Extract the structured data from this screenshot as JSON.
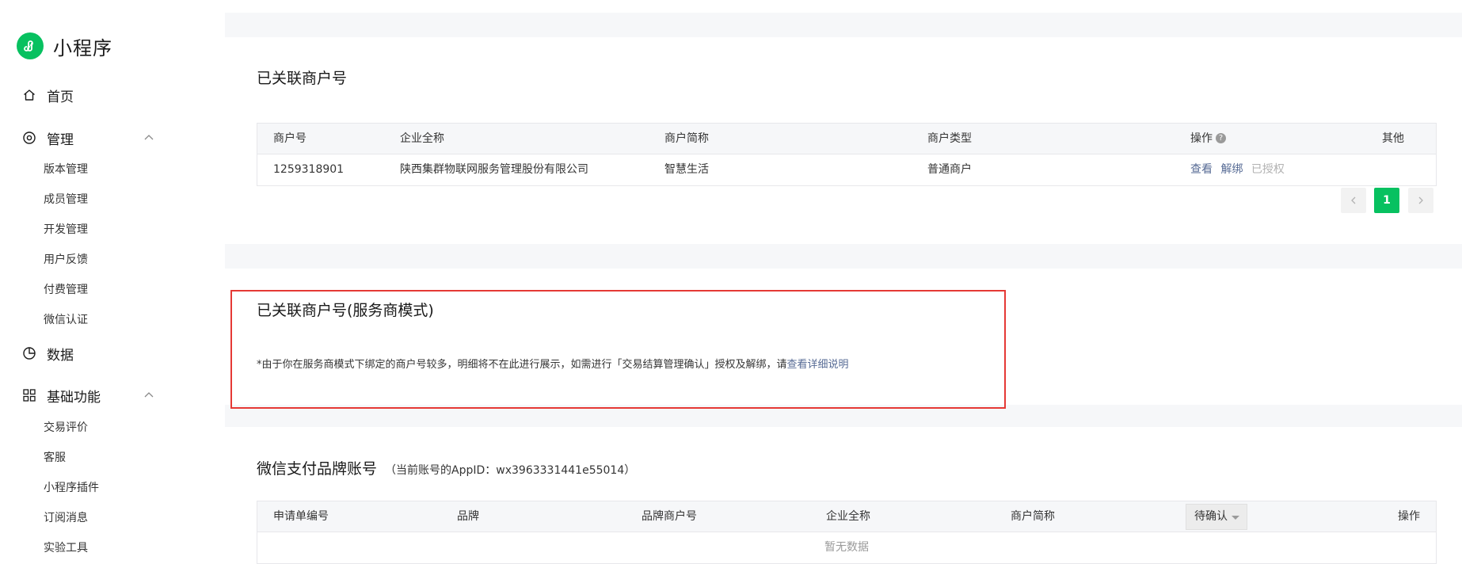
{
  "app": {
    "title": "小程序"
  },
  "sidebar": {
    "home": "首页",
    "manage": {
      "label": "管理",
      "items": [
        "版本管理",
        "成员管理",
        "开发管理",
        "用户反馈",
        "付费管理",
        "微信认证"
      ]
    },
    "data": "数据",
    "basic": {
      "label": "基础功能",
      "items": [
        "交易评价",
        "客服",
        "小程序插件",
        "订阅消息",
        "实验工具"
      ]
    }
  },
  "merchants": {
    "title": "已关联商户号",
    "columns": {
      "id": "商户号",
      "company": "企业全称",
      "short": "商户简称",
      "type": "商户类型",
      "ops": "操作",
      "other": "其他"
    },
    "rows": [
      {
        "id": "1259318901",
        "company": "陕西集群物联网服务管理股份有限公司",
        "short": "智慧生活",
        "type": "普通商户",
        "view": "查看",
        "unbind": "解绑",
        "authorized": "已授权"
      }
    ],
    "pagination": {
      "current": "1"
    }
  },
  "service_mode": {
    "title": "已关联商户号(服务商模式)",
    "notice": "*由于你在服务商模式下绑定的商户号较多，明细将不在此进行展示，如需进行「交易结算管理确认」授权及解绑，请",
    "notice_link": "查看详细说明"
  },
  "brand_account": {
    "title": "微信支付品牌账号",
    "subtitle": "（当前账号的AppID：wx3963331441e55014）",
    "columns": {
      "apply_no": "申请单编号",
      "brand": "品牌",
      "brand_merchant": "品牌商户号",
      "company": "企业全称",
      "short": "商户简称",
      "status_filter": "待确认",
      "ops": "操作"
    },
    "empty": "暂无数据"
  },
  "colors": {
    "accent": "#07c160",
    "link": "#576b95",
    "highlight": "#e53935"
  }
}
